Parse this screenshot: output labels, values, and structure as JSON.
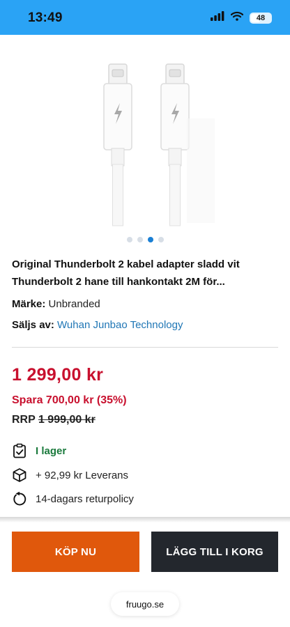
{
  "status_bar": {
    "time": "13:49",
    "battery": "48",
    "battery_level": 0.48,
    "icons": [
      "signal-icon",
      "wifi-icon",
      "battery-icon"
    ],
    "background": "#2aa3f5"
  },
  "gallery": {
    "image_alt": "product-image-thunderbolt-cables",
    "total_images": 4,
    "active_index": 2
  },
  "product": {
    "title": "Original Thunderbolt 2 kabel adapter sladd vit Thunderbolt 2 hane till hankontakt 2M för...",
    "brand_label": "Märke:",
    "brand_value": "Unbranded",
    "seller_label": "Säljs av:",
    "seller_value": "Wuhan Junbao Technology"
  },
  "pricing": {
    "price": "1 299,00 kr",
    "savings": "Spara 700,00 kr (35%)",
    "rrp_label": "RRP",
    "rrp_value": "1 999,00 kr",
    "price_color": "#c8102e"
  },
  "info": {
    "stock": "I lager",
    "shipping": "+ 92,99 kr Leverans",
    "returns": "14-dagars returpolicy",
    "stock_color": "#1a7a3c"
  },
  "actions": {
    "buy_now": "KÖP NU",
    "add_to_cart": "LÄGG TILL I KORG",
    "buy_color": "#e0580c",
    "cart_color": "#23272d"
  },
  "browser": {
    "url": "fruugo.se"
  }
}
